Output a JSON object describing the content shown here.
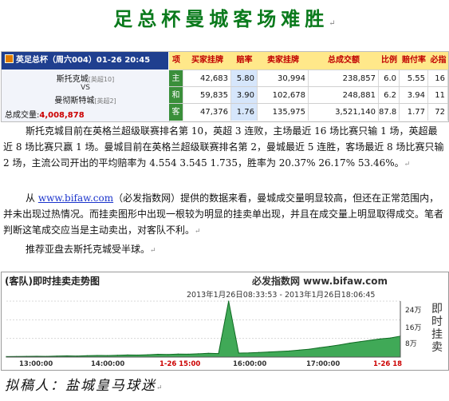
{
  "title": "足总杯曼城客场难胜",
  "para_mark": "↵",
  "table": {
    "match_label": "英足总杯（周六004）01-26 20:45",
    "headers": [
      "项",
      "买家挂牌",
      "赔率",
      "卖家挂牌",
      "总成交额",
      "比例",
      "赔付率",
      "必指"
    ],
    "home": "斯托克城",
    "home_rank": "[英超10]",
    "vs": "VS",
    "away": "曼彻斯特城",
    "away_rank": "[英超2]",
    "total_label": "总成交量:",
    "total_value": "4,008,878",
    "rows": [
      {
        "label": "主",
        "buy": "42,683",
        "odds": "5.80",
        "sell": "30,994",
        "total": "238,857",
        "ratio": "6.0",
        "payout": "5.55",
        "index": "16"
      },
      {
        "label": "和",
        "buy": "59,835",
        "odds": "3.90",
        "sell": "102,678",
        "total": "248,881",
        "ratio": "6.2",
        "payout": "3.94",
        "index": "11"
      },
      {
        "label": "客",
        "buy": "47,376",
        "odds": "1.76",
        "sell": "135,975",
        "total": "3,521,140",
        "ratio": "87.8",
        "payout": "1.77",
        "index": "72"
      }
    ]
  },
  "paragraphs": {
    "p1": "斯托克城目前在英格兰超级联赛排名第 10，英超 3 连败，主场最近 16 场比赛只输 1 场，英超最近 8 场比赛只赢 1 场。曼城目前在英格兰超级联赛排名第 2，曼城最近 5 连胜，客场最近 8 场比赛只输 2 场，主流公司开出的平均赔率为 4.554 3.545 1.735，胜率为 20.37% 26.17% 53.46%。",
    "p2_pre": "从 ",
    "p2_link": "www.bifaw.com",
    "p2_post": "（必发指数网）提供的数据来看，曼城成交量明显较高，但还在正常范围内，并未出现过热情况。而挂卖图形中出现一根较为明显的挂卖单出现，并且在成交量上明显取得成交。笔者判断这笔成交应当是主动卖出，对客队不利。",
    "p3": "推荐亚盘去斯托克城受半球。"
  },
  "chart": {
    "title": "(客队)即时挂卖走势图",
    "site": "必发指数网 www.bifaw.com",
    "range": "2013年1月26日08:33:53 - 2013年1月26日18:06:45",
    "side_label": "即时挂卖",
    "x_ticks": [
      "13:00:00",
      "14:00:00",
      "1-26 15:00",
      "16:00:00",
      "17:00:00",
      "1-26 18"
    ],
    "y_ticks": [
      "24万",
      "16万",
      "8万"
    ]
  },
  "chart_data": {
    "type": "area",
    "title": "(客队)即时挂卖走势图",
    "y_ticks": [
      "24万",
      "16万",
      "8万"
    ],
    "x_ticks": [
      "13:00:00",
      "14:00:00",
      "1-26 15:00",
      "16:00:00",
      "17:00:00",
      "1-26 18"
    ],
    "ylim": [
      0,
      240000
    ],
    "series": [
      {
        "values": [
          2000,
          2500,
          3000,
          3500,
          3000,
          4000,
          5000,
          4500,
          6000,
          7000,
          6500,
          8000,
          9000,
          8500,
          10000,
          12000,
          11000,
          13000,
          12500,
          14000,
          16000,
          15000,
          240000,
          17000,
          18000,
          20000,
          22000,
          24000,
          26000,
          30000,
          34000,
          40000,
          46000,
          52000,
          60000,
          66000,
          72000,
          78000,
          82000,
          90000
        ]
      }
    ],
    "colors": {
      "area": "#1e9a3a",
      "line": "#0e6a22",
      "spike": "#3bbf4f"
    }
  },
  "author": "拟稿人：盐城皇马球迷"
}
